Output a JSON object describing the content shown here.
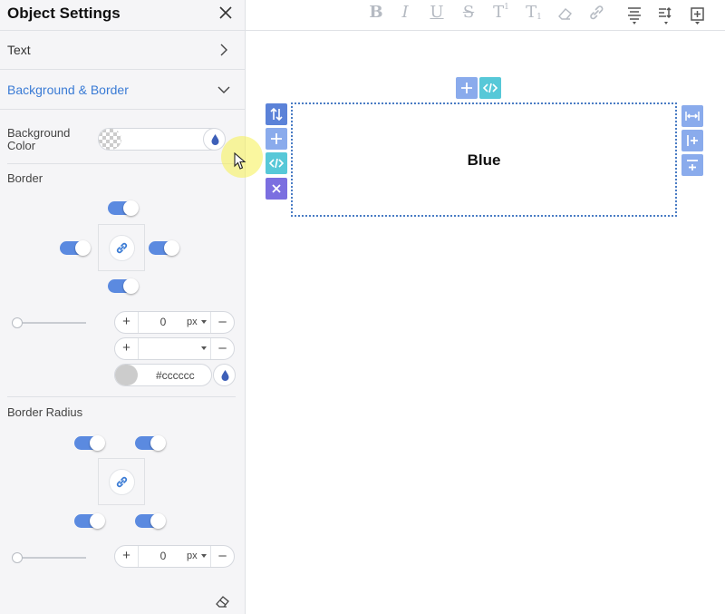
{
  "panel": {
    "title": "Object Settings",
    "sections": [
      {
        "label": "Text",
        "expanded": false
      },
      {
        "label": "Background & Border",
        "expanded": true
      }
    ],
    "background_color": {
      "label": "Background Color",
      "label_line1": "Background",
      "label_line2": "Color",
      "value": ""
    },
    "border": {
      "label": "Border",
      "width": {
        "value": "0",
        "unit": "px"
      },
      "style": {
        "value": ""
      },
      "color": {
        "hex": "#cccccc"
      }
    },
    "border_radius": {
      "label": "Border Radius",
      "value": "0",
      "unit": "px"
    },
    "stepper_plus": "+",
    "stepper_minus": "–"
  },
  "toolbar": {
    "bold": "B",
    "italic": "I",
    "underline": "U",
    "strike": "S",
    "superscript": "T",
    "subscript": "T"
  },
  "canvas": {
    "element_text": "Blue"
  },
  "colors": {
    "accent": "#3a7bd5",
    "toggle": "#5b8ae0",
    "swatch": "#cccccc",
    "element_border": "#4a7cc4"
  }
}
